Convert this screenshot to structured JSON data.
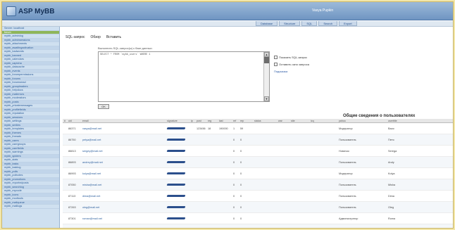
{
  "header": {
    "app_title": "ASP MyBB",
    "user_text": "Vasya Pupkin"
  },
  "toolbar": {
    "tabs": [
      "Database",
      "Structure",
      "SQL",
      "Search",
      "Export"
    ]
  },
  "sidebar": {
    "items": [
      "Server: localhost",
      "forum",
      "mybb_adminlog",
      "mybb_adminsessions",
      "mybb_attachments",
      "mybb_awaitingactivation",
      "mybb_badwords",
      "mybb_banned",
      "mybb_calendars",
      "mybb_captcha",
      "mybb_datacache",
      "mybb_events",
      "mybb_forumpermissions",
      "mybb_forums",
      "mybb_forumsread",
      "mybb_groupleaders",
      "mybb_helpdocs",
      "mybb_mailerrors",
      "mybb_moderators",
      "mybb_posts",
      "mybb_privatemessages",
      "mybb_profilefields",
      "mybb_reputation",
      "mybb_sessions",
      "mybb_settings",
      "mybb_smilies",
      "mybb_templates",
      "mybb_themes",
      "mybb_threads",
      "mybb_users",
      "mybb_usergroups",
      "mybb_userfields",
      "mybb_warnings",
      "mybb_spiders",
      "mybb_stats",
      "mybb_tasks",
      "mybb_tasklog",
      "mybb_polls",
      "mybb_pollvotes",
      "mybb_promotions",
      "mybb_reportedposts",
      "mybb_searchlog",
      "mybb_mycode",
      "mybb_icons",
      "mybb_modtools",
      "mybb_mailqueue",
      "mybb_maillogs"
    ]
  },
  "sql": {
    "tabs": [
      "SQL-запрос",
      "Обзор",
      "Вставить"
    ],
    "label": "Выполнить SQL-запрос(ы) к базе данных:",
    "query": "SELECT * FROM `mybb_users` WHERE 1",
    "opt1": "Показать SQL-запрос",
    "opt2": "Оставить окно запроса",
    "link": "Подсказка",
    "go": "OK"
  },
  "results": {
    "title": "Общие сведения о пользователях",
    "headers": [
      "#",
      "uid",
      "email",
      "signature",
      "ip",
      "post",
      "reg",
      "last",
      "ref",
      "rep",
      "status",
      "war",
      "site",
      "icq",
      "yahoo",
      "usertitle"
    ],
    "rows": [
      [
        "",
        "86371",
        "vasya@mail.net",
        "",
        "",
        "123456",
        "18",
        "190000",
        "1",
        "59",
        "",
        "",
        "",
        "",
        "Модератор",
        "Вася"
      ],
      [
        "",
        "86750",
        "petya@mail.net",
        "",
        "",
        "",
        "",
        "",
        "0",
        "0",
        "",
        "",
        "",
        "",
        "Пользователь",
        "Петя"
      ],
      [
        "",
        "86813",
        "sergey@mail.net",
        "",
        "",
        "",
        "",
        "",
        "0",
        "0",
        "",
        "",
        "",
        "",
        "Новичок",
        "Serega"
      ],
      [
        "",
        "86893",
        "andrey@mail.net",
        "",
        "",
        "",
        "",
        "",
        "0",
        "0",
        "",
        "",
        "",
        "",
        "Пользователь",
        "Andy"
      ],
      [
        "",
        "86993",
        "kolya@mail.net",
        "",
        "",
        "",
        "",
        "",
        "0",
        "0",
        "",
        "",
        "",
        "",
        "Модератор",
        "Kolya"
      ],
      [
        "",
        "87050",
        "misha@mail.net",
        "",
        "",
        "",
        "",
        "",
        "0",
        "0",
        "",
        "",
        "",
        "",
        "Пользователь",
        "Misha"
      ],
      [
        "",
        "87113",
        "dima@mail.net",
        "",
        "",
        "",
        "",
        "",
        "0",
        "0",
        "",
        "",
        "",
        "",
        "Пользователь",
        "Dima"
      ],
      [
        "",
        "87263",
        "oleg@mail.net",
        "",
        "",
        "",
        "",
        "",
        "0",
        "0",
        "",
        "",
        "",
        "",
        "Пользователь",
        "Oleg"
      ],
      [
        "",
        "87301",
        "roman@mail.net",
        "",
        "",
        "",
        "",
        "",
        "0",
        "0",
        "",
        "",
        "",
        "",
        "Администратор",
        "Roma"
      ],
      [
        "",
        "87399",
        "nikita@mail.net",
        "",
        "",
        "",
        "",
        "",
        "0",
        "0",
        "",
        "",
        "",
        "",
        "Пользователь",
        "Nikita"
      ]
    ]
  }
}
